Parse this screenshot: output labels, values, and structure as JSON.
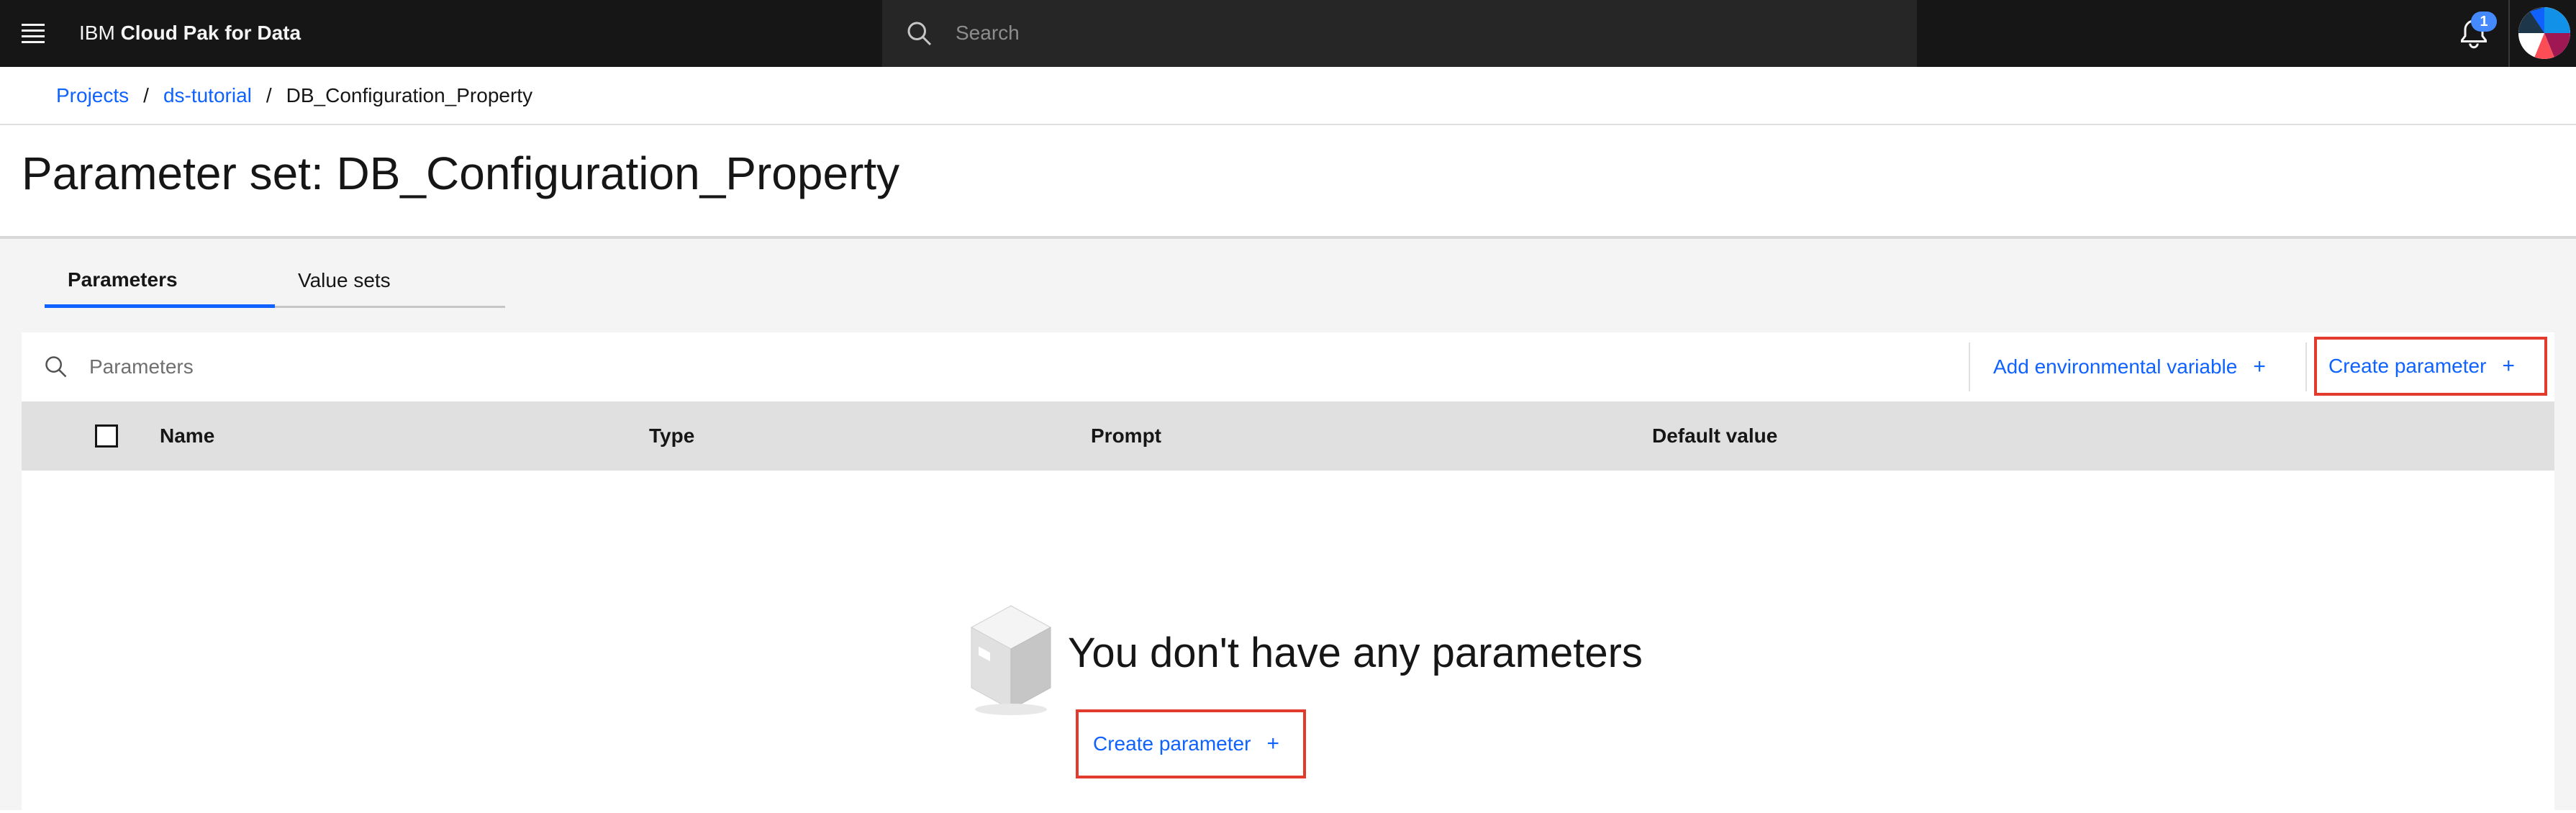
{
  "header": {
    "brand_prefix": "IBM",
    "brand_name": "Cloud Pak for Data",
    "search_placeholder": "Search",
    "notification_count": "1",
    "icons": [
      "menu-icon",
      "search-icon",
      "bell-icon",
      "avatar"
    ]
  },
  "breadcrumb": {
    "items": [
      {
        "label": "Projects"
      },
      {
        "label": "ds-tutorial"
      },
      {
        "label": "DB_Configuration_Property"
      }
    ],
    "separator": "/"
  },
  "page": {
    "title": "Parameter set: DB_Configuration_Property"
  },
  "tabs": [
    {
      "label": "Parameters",
      "selected": true
    },
    {
      "label": "Value sets",
      "selected": false
    }
  ],
  "toolbar": {
    "search_placeholder": "Parameters",
    "add_env_label": "Add environmental variable",
    "create_label": "Create parameter",
    "plus": "+"
  },
  "table": {
    "columns": [
      "Name",
      "Type",
      "Prompt",
      "Default value"
    ],
    "rows": []
  },
  "empty_state": {
    "title": "You don't have any parameters",
    "create_label": "Create parameter",
    "plus": "+"
  },
  "colors": {
    "accent": "#0f62fe",
    "header_bg": "#161616",
    "highlight_border": "#e23b2e",
    "badge": "#4589ff"
  }
}
